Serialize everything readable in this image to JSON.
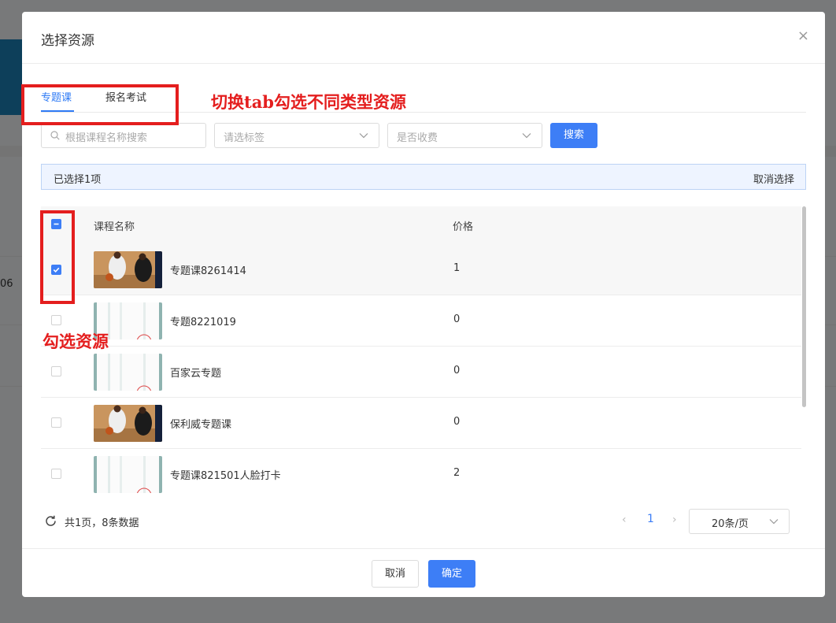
{
  "background": {
    "visible_text": "06"
  },
  "modal": {
    "title": "选择资源",
    "close_glyph": "×"
  },
  "tabs": [
    {
      "label": "专题课",
      "active": true
    },
    {
      "label": "报名考试",
      "active": false
    }
  ],
  "filters": {
    "search_placeholder": "根据课程名称搜索",
    "tag_placeholder": "请选标签",
    "fee_placeholder": "是否收费",
    "search_button": "搜索"
  },
  "selection": {
    "summary": "已选择1项",
    "clear_label": "取消选择"
  },
  "table": {
    "headers": {
      "name": "课程名称",
      "price": "价格"
    },
    "rows": [
      {
        "name": "专题课8261414",
        "price": "1",
        "thumb": "basketball-image",
        "checked": true
      },
      {
        "name": "专题8221019",
        "price": "0",
        "thumb": "document-image",
        "checked": false
      },
      {
        "name": "百家云专题",
        "price": "0",
        "thumb": "document-image",
        "checked": false
      },
      {
        "name": "保利威专题课",
        "price": "0",
        "thumb": "basketball-image",
        "checked": false
      },
      {
        "name": "专题课821501人脸打卡",
        "price": "2",
        "thumb": "document-image",
        "checked": false
      }
    ]
  },
  "pagination": {
    "summary": "共1页，8条数据",
    "prev_glyph": "‹",
    "current_page": "1",
    "next_glyph": "›",
    "page_size": "20条/页"
  },
  "footer": {
    "cancel_label": "取消",
    "ok_label": "确定"
  },
  "annotations": {
    "tab_note": "切换tab勾选不同类型资源",
    "check_note": "勾选资源"
  },
  "colors": {
    "primary": "#3d7ef6",
    "annotation": "#e41e1e"
  }
}
